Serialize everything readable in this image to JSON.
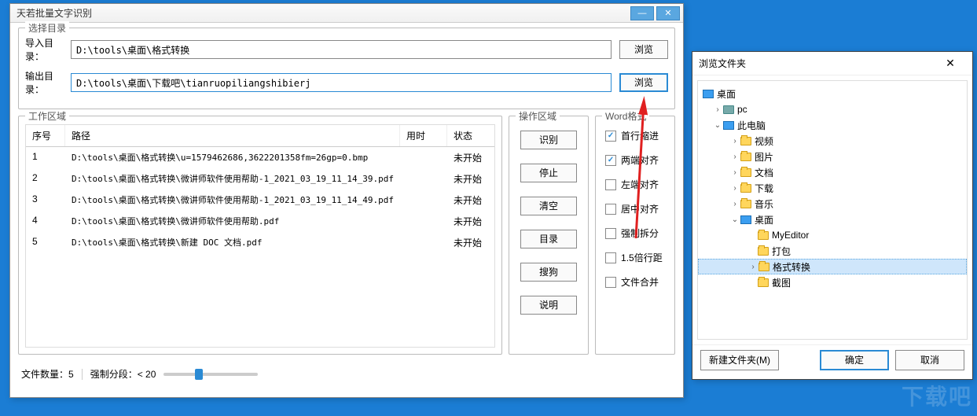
{
  "main": {
    "title": "天若批量文字识别",
    "dir_group": "选择目录",
    "import_label": "导入目录：",
    "import_value": "D:\\tools\\桌面\\格式转换",
    "output_label": "输出目录：",
    "output_value": "D:\\tools\\桌面\\下载吧\\tianruopiliangshibierj",
    "browse": "浏览",
    "workarea_legend": "工作区域",
    "cols": {
      "idx": "序号",
      "path": "路径",
      "time": "用时",
      "status": "状态"
    },
    "rows": [
      {
        "idx": "1",
        "path": "D:\\tools\\桌面\\格式转换\\u=1579462686,3622201358fm=26gp=0.bmp",
        "status": "未开始"
      },
      {
        "idx": "2",
        "path": "D:\\tools\\桌面\\格式转换\\微讲师软件使用帮助-1_2021_03_19_11_14_39.pdf",
        "status": "未开始"
      },
      {
        "idx": "3",
        "path": "D:\\tools\\桌面\\格式转换\\微讲师软件使用帮助-1_2021_03_19_11_14_49.pdf",
        "status": "未开始"
      },
      {
        "idx": "4",
        "path": "D:\\tools\\桌面\\格式转换\\微讲师软件使用帮助.pdf",
        "status": "未开始"
      },
      {
        "idx": "5",
        "path": "D:\\tools\\桌面\\格式转换\\新建 DOC 文档.pdf",
        "status": "未开始"
      }
    ],
    "ops_legend": "操作区域",
    "ops": {
      "ocr": "识别",
      "stop": "停止",
      "clear": "清空",
      "dir": "目录",
      "sogou": "搜狗",
      "help": "说明"
    },
    "word_legend": "Word格式",
    "word": {
      "indent": "首行缩进",
      "justify": "两端对齐",
      "left": "左端对齐",
      "center": "居中对齐",
      "split": "强制拆分",
      "spacing": "1.5倍行距",
      "merge": "文件合并"
    },
    "footer": {
      "count_label": "文件数量：",
      "count_value": "5",
      "seg_label": "强制分段：< 20"
    }
  },
  "browse": {
    "title": "浏览文件夹",
    "tree": {
      "desktop": "桌面",
      "pc": "pc",
      "thispc": "此电脑",
      "video": "视频",
      "pictures": "图片",
      "docs": "文档",
      "downloads": "下载",
      "music": "音乐",
      "desktop2": "桌面",
      "myeditor": "MyEditor",
      "pack": "打包",
      "convert": "格式转换",
      "screenshot": "截图"
    },
    "btns": {
      "newfolder": "新建文件夹(M)",
      "ok": "确定",
      "cancel": "取消"
    }
  },
  "watermark": "下载吧"
}
